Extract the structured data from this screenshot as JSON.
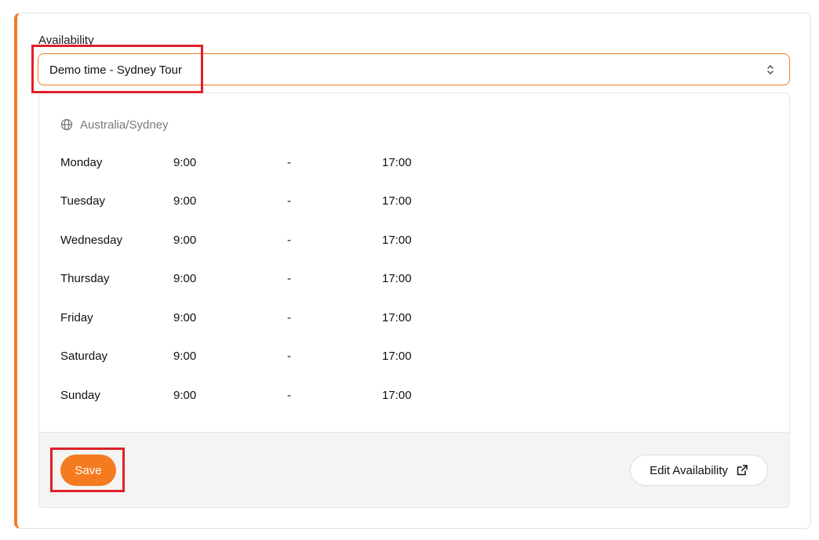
{
  "availability": {
    "label": "Availability",
    "selected": "Demo time - Sydney Tour",
    "timezone": "Australia/Sydney",
    "timezone_icon": "globe-icon",
    "chevron_icon": "chevron-up-down-icon",
    "schedule": [
      {
        "day": "Monday",
        "start": "9:00",
        "separator": "-",
        "end": "17:00"
      },
      {
        "day": "Tuesday",
        "start": "9:00",
        "separator": "-",
        "end": "17:00"
      },
      {
        "day": "Wednesday",
        "start": "9:00",
        "separator": "-",
        "end": "17:00"
      },
      {
        "day": "Thursday",
        "start": "9:00",
        "separator": "-",
        "end": "17:00"
      },
      {
        "day": "Friday",
        "start": "9:00",
        "separator": "-",
        "end": "17:00"
      },
      {
        "day": "Saturday",
        "start": "9:00",
        "separator": "-",
        "end": "17:00"
      },
      {
        "day": "Sunday",
        "start": "9:00",
        "separator": "-",
        "end": "17:00"
      }
    ]
  },
  "footer": {
    "save_label": "Save",
    "edit_label": "Edit Availability",
    "edit_icon": "external-link-icon"
  },
  "colors": {
    "accent": "#f47b20",
    "highlight": "#e0202a",
    "footer_bg": "#f4f4f2"
  }
}
